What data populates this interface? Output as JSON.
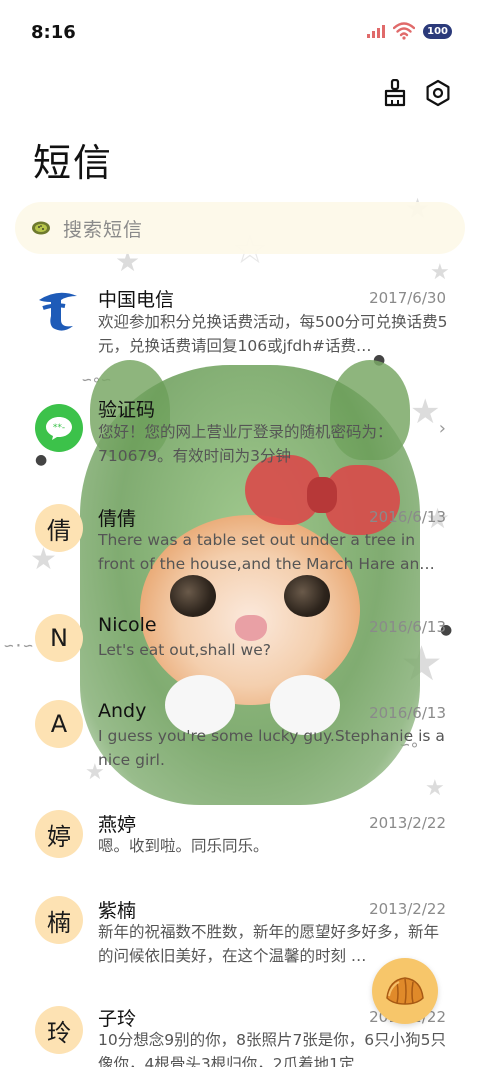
{
  "status_bar": {
    "time": "8:16",
    "battery": "100"
  },
  "toolbar": {
    "clean_icon": "broom-icon",
    "settings_icon": "gear-icon"
  },
  "header": {
    "title": "短信"
  },
  "search": {
    "placeholder": "搜索短信"
  },
  "conversations": [
    {
      "name": "中国电信",
      "date": "2017/6/30",
      "preview": "欢迎参加积分兑换话费活动，每500分可兑换话费5元，兑换话费请回复106或jfdh#话费…",
      "avatar_type": "logo"
    },
    {
      "name": "验证码",
      "date": "",
      "preview": "您好！您的网上营业厅登录的随机密码为：710679。有效时间为3分钟",
      "avatar_type": "message-icon"
    },
    {
      "name": "倩倩",
      "date": "2016/6/13",
      "preview": "There was a table set out under a tree in front of the house,and the March Hare an…",
      "avatar_letter": "倩"
    },
    {
      "name": "Nicole",
      "date": "2016/6/13",
      "preview": "Let's eat out,shall we?",
      "avatar_letter": "N"
    },
    {
      "name": "Andy",
      "date": "2016/6/13",
      "preview": "I guess you're some lucky guy.Stephanie is a nice girl.",
      "avatar_letter": "A"
    },
    {
      "name": "燕婷",
      "date": "2013/2/22",
      "preview": "嗯。收到啦。同乐同乐。",
      "avatar_letter": "婷"
    },
    {
      "name": "紫楠",
      "date": "2013/2/22",
      "preview": "新年的祝福数不胜数，新年的愿望好多好多，新年的问候依旧美好，在这个温馨的时刻 …",
      "avatar_letter": "楠"
    },
    {
      "name": "子玲",
      "date": "2013/2/22",
      "preview": "10分想念9别的你，8张照片7张是你，6只小狗5只像你，4根骨头3根归你，2爪着地1定",
      "avatar_letter": "玲"
    }
  ],
  "fab": {
    "icon": "croissant-icon"
  },
  "colors": {
    "avatar_bg": "#fde2b3",
    "search_bg": "#fdf8e8",
    "fab_bg": "#f7c66a",
    "telecom_blue": "#1e5bb8",
    "message_green": "#3cc24a"
  }
}
